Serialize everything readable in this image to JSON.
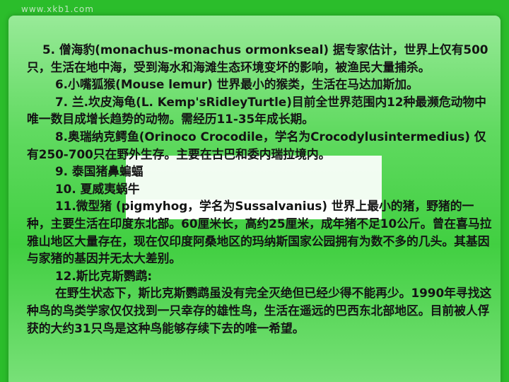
{
  "watermark": "www.xkb1.com",
  "paragraphs": [
    "5. 僧海豹(monachus-monachus ormonkseal) 据专家估计，世界上仅有500只，生活在地中海，受到海水和海滩生态环境变坏的影响，被渔民大量捕杀。",
    "6.小嘴狐猴(Mouse lemur) 世界最小的猴类，生活在马达加斯加。",
    "7. 兰.坎皮海龟(L. Kemp'sRidleyTurtle)目前全世界范围内12种最濒危动物中唯一数目成增长趋势的动物。需经历11-35年成长期。",
    "8.奥瑞纳克鳄鱼(Orinoco Crocodile，学名为Crocodylusintermedius) 仅有250-700只在野外生存。主要在古巴和委内瑞拉境内。",
    "9. 泰国猪鼻蝙蝠",
    "10. 夏威夷蜗牛",
    "11.微型猪 (pigmyhog，学名为Sussalvanius) 世界上最小的猪，野猪的一种，主要生活在印度东北部。60厘米长，高约25厘米，成年猪不足10公斤。曾在喜马拉雅山地区大量存在，现在仅印度阿桑地区的玛纳斯国家公园拥有为数不多的几头。其基因与家猪的基因并无太大差别。",
    "12.斯比克斯鹦鹉:",
    "在野生状态下，斯比克斯鹦鹉虽没有完全灭绝但已经少得不能再少。1990年寻找这种鸟的鸟类学家仅仅找到一只幸存的雄性鸟，生活在遥远的巴西东北部地区。目前被人俘获的大约31只鸟是这种鸟能够存续下去的唯一希望。"
  ]
}
